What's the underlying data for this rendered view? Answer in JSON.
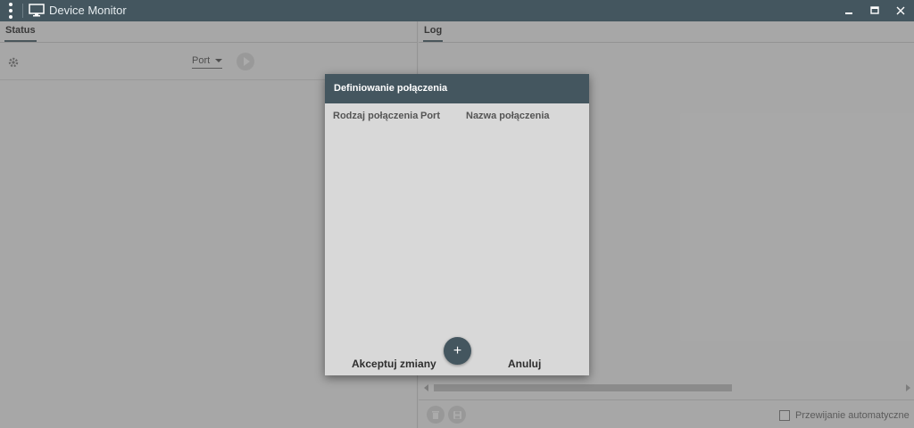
{
  "app": {
    "title": "Device Monitor"
  },
  "status_pane": {
    "tab_label": "Status",
    "port": {
      "selected": "Port"
    }
  },
  "log_pane": {
    "tab_label": "Log",
    "auto_scroll": {
      "label": "Przewijanie automatyczne",
      "checked": false
    }
  },
  "dialog": {
    "title": "Definiowanie połączenia",
    "columns": [
      "Rodzaj połączenia",
      "Port",
      "Nazwa połączenia"
    ],
    "add_symbol": "+",
    "accept_label": "Akceptuj zmiany",
    "cancel_label": "Anuluj"
  },
  "colors": {
    "titlebar": "#44565f",
    "dialog_header": "#44565f",
    "dialog_body": "#d8d8d8"
  }
}
